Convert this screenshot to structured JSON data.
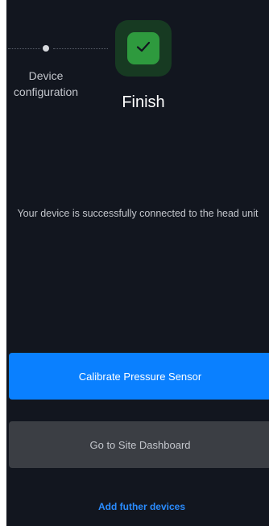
{
  "stepper": {
    "previous_step_label": "Device configuration",
    "current_step_label": "Finish",
    "current_step_icon": "check-icon"
  },
  "message": "Your device is successfully connected to the head unit",
  "buttons": {
    "primary_label": "Calibrate Pressure Sensor",
    "secondary_label": "Go to Site Dashboard"
  },
  "link_label": "Add futher devices",
  "colors": {
    "background": "#12161f",
    "primary": "#0a80ff",
    "secondary": "#3b3e44",
    "success": "#2e9a3e",
    "link": "#2a8cff"
  }
}
